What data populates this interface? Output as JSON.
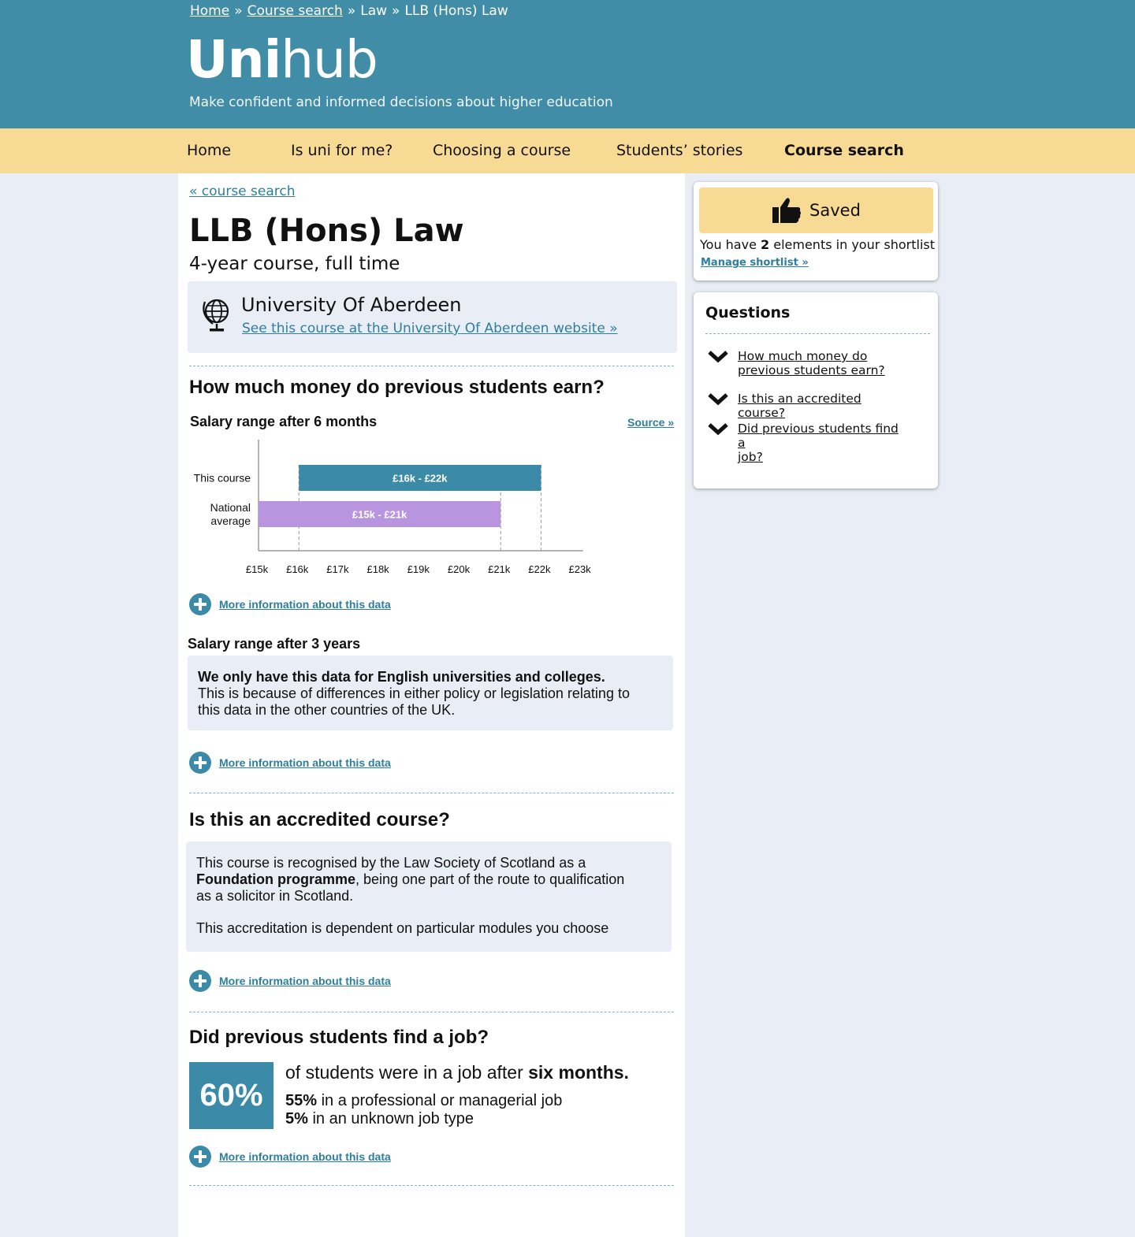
{
  "breadcrumb": {
    "home": "Home",
    "sep1": "»",
    "course_search": "Course search",
    "sep2": "»",
    "law": "Law",
    "sep3": "»",
    "current": "LLB (Hons) Law"
  },
  "logo": {
    "bold": "Uni",
    "light": "hub"
  },
  "tagline": "Make confident and informed decisions about higher education",
  "nav": {
    "items": [
      "Home",
      "Is uni for me?",
      "Choosing a course",
      "Students’ stories",
      "Course search"
    ],
    "active": "Course search"
  },
  "main": {
    "back_link": "« course search",
    "course_title": "LLB (Hons) Law",
    "course_subtitle": "4-year course, full time",
    "university": {
      "name": "University Of Aberdeen",
      "link": "See this course at the University Of Aberdeen website »",
      "icon": "globe-icon"
    },
    "salary": {
      "heading": "How much money do previous students earn?",
      "six_months_title": "Salary range after 6 months",
      "source": "Source »",
      "more_info": "More information about this data",
      "three_years_title": "Salary range after 3 years",
      "three_years_note_bold": "We only have this data for English universities and colleges.",
      "three_years_note_line1": "This is because of differences in either policy or legislation relating to",
      "three_years_note_line2": "this data in the other countries of the UK.",
      "more_info_2": "More information about this data"
    },
    "accreditation": {
      "heading": "Is this an accredited course?",
      "line1": "This course is recognised by the Law Society of Scotland as a",
      "bold": "Foundation programme",
      "line2_rest": ", being one part of the route to qualification",
      "line3": "as a solicitor in Scotland.",
      "line4": "This accreditation is dependent on particular modules you choose",
      "more_info": "More information about this data"
    },
    "jobs": {
      "heading": "Did previous students find a job?",
      "percent": "60%",
      "headline_start": "of students were in a job after ",
      "headline_bold": "six months.",
      "professional_pct": "55%",
      "professional_text": " in a professional or managerial job",
      "unknown_pct": "5%",
      "unknown_text": " in an unknown job type",
      "more_info": "More information about this data"
    }
  },
  "sidebar": {
    "saved_label": "Saved",
    "shortlist_prefix": "You have ",
    "shortlist_count": "2",
    "shortlist_suffix": " elements in your shortlist",
    "manage_link": "Manage shortlist »",
    "questions_title": "Questions",
    "questions": [
      {
        "line1": "How much money do",
        "line2": "previous students earn?"
      },
      {
        "line1": "Is this an accredited course?",
        "line2": ""
      },
      {
        "line1": "Did previous students find a",
        "line2": "job?"
      }
    ]
  },
  "colors": {
    "header": "#418da8",
    "nav": "#f7da94",
    "this_course_bar": "#3a8aa8",
    "national_bar": "#b995e0",
    "link": "#2d7f9d"
  },
  "chart_data": {
    "type": "bar",
    "title": "Salary range after 6 months",
    "orientation": "horizontal-range",
    "categories": [
      "This course",
      "National average"
    ],
    "category_lines": [
      [
        "This course"
      ],
      [
        "National",
        "average"
      ]
    ],
    "series": [
      {
        "category": "This course",
        "min": 16,
        "max": 22,
        "label": "£16k - £22k",
        "color": "#3a8aa8"
      },
      {
        "category": "National average",
        "min": 15,
        "max": 21,
        "label": "£15k - £21k",
        "color": "#b995e0"
      }
    ],
    "xlim": [
      15,
      23
    ],
    "x_ticks": [
      "£15k",
      "£16k",
      "£17k",
      "£18k",
      "£19k",
      "£20k",
      "£21k",
      "£22k",
      "£23k"
    ],
    "unit": "£k"
  }
}
